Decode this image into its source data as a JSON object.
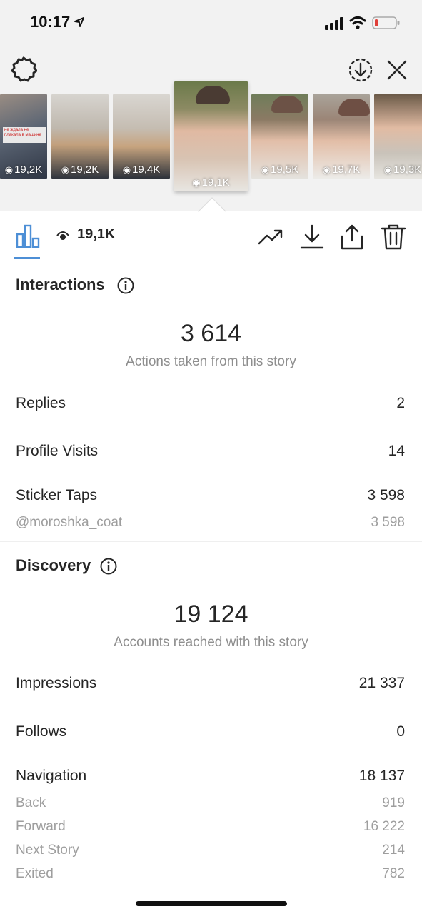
{
  "status_bar": {
    "time": "10:17",
    "icons": [
      "location-arrow-icon",
      "signal-icon",
      "wifi-icon",
      "battery-low-icon"
    ],
    "battery_color": "#e0403a"
  },
  "header": {
    "icons": [
      "settings-icon",
      "download-circle-icon",
      "close-icon"
    ]
  },
  "thumbnails": [
    {
      "views": "19,2K",
      "banner": "не ждала не плакала в машине"
    },
    {
      "views": "19,2K"
    },
    {
      "views": "19,4K"
    },
    {
      "views": "19,1K",
      "selected": true
    },
    {
      "views": "19,5K"
    },
    {
      "views": "19,7K"
    },
    {
      "views": "19,3K"
    }
  ],
  "toolbar": {
    "views": "19,1K",
    "accent_color": "#4d8fd6",
    "icons": [
      "insights-bars-icon",
      "eye-icon",
      "trend-icon",
      "download-icon",
      "share-icon",
      "trash-icon"
    ]
  },
  "interactions": {
    "title": "Interactions",
    "total": "3 614",
    "caption": "Actions taken from this story",
    "rows": [
      {
        "label": "Replies",
        "value": "2"
      },
      {
        "label": "Profile Visits",
        "value": "14"
      },
      {
        "label": "Sticker Taps",
        "value": "3 598"
      }
    ],
    "sticker_detail": {
      "label": "@moroshka_coat",
      "value": "3 598"
    }
  },
  "discovery": {
    "title": "Discovery",
    "total": "19 124",
    "caption": "Accounts reached with this story",
    "rows": [
      {
        "label": "Impressions",
        "value": "21 337"
      },
      {
        "label": "Follows",
        "value": "0"
      },
      {
        "label": "Navigation",
        "value": "18 137"
      }
    ],
    "navigation_detail": [
      {
        "label": "Back",
        "value": "919"
      },
      {
        "label": "Forward",
        "value": "16 222"
      },
      {
        "label": "Next Story",
        "value": "214"
      },
      {
        "label": "Exited",
        "value": "782"
      }
    ]
  }
}
